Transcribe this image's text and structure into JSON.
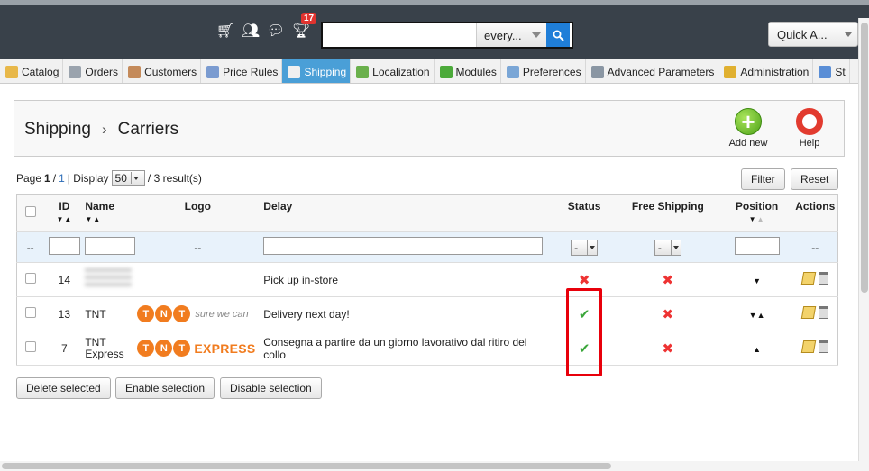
{
  "header": {
    "notifications_count": "17",
    "search": {
      "value": "",
      "placeholder": "",
      "scope": "every..."
    },
    "quick_access": "Quick A..."
  },
  "menu": [
    {
      "label": "Catalog",
      "icon": "folder-icon",
      "color": "#e8b84a"
    },
    {
      "label": "Orders",
      "icon": "cart-icon",
      "color": "#9aa3ad"
    },
    {
      "label": "Customers",
      "icon": "user-icon",
      "color": "#c48a5a"
    },
    {
      "label": "Price Rules",
      "icon": "price-tag-icon",
      "color": "#7a9bd0"
    },
    {
      "label": "Shipping",
      "icon": "truck-icon",
      "color": "#f0f0f0",
      "active": true
    },
    {
      "label": "Localization",
      "icon": "globe-icon",
      "color": "#6ab04c"
    },
    {
      "label": "Modules",
      "icon": "puzzle-icon",
      "color": "#4caa3a"
    },
    {
      "label": "Preferences",
      "icon": "window-icon",
      "color": "#7aa6d6"
    },
    {
      "label": "Advanced Parameters",
      "icon": "wrench-icon",
      "color": "#8a96a3"
    },
    {
      "label": "Administration",
      "icon": "key-icon",
      "color": "#e0b030"
    },
    {
      "label": "St",
      "icon": "stats-icon",
      "color": "#5a8ed6"
    }
  ],
  "page": {
    "breadcrumb": [
      "Shipping",
      "Carriers"
    ],
    "toolbar": {
      "add_new": "Add new",
      "help": "Help"
    }
  },
  "pagination": {
    "page_label": "Page",
    "current": "1",
    "total": "1",
    "display_label": "| Display",
    "per_page": "50",
    "results": "/ 3 result(s)",
    "filter": "Filter",
    "reset": "Reset"
  },
  "table": {
    "columns": {
      "id": "ID",
      "name": "Name",
      "logo": "Logo",
      "delay": "Delay",
      "status": "Status",
      "free_shipping": "Free Shipping",
      "position": "Position",
      "actions": "Actions"
    },
    "filter_row": {
      "dash": "--",
      "status_select": "-",
      "free_select": "-"
    },
    "rows": [
      {
        "id": "14",
        "name": "",
        "logo": "",
        "delay": "Pick up in-store",
        "status": "disabled",
        "free_shipping": "no",
        "position": "down"
      },
      {
        "id": "13",
        "name": "TNT",
        "logo": "TNT sure we can",
        "delay": "Delivery next day!",
        "status": "enabled",
        "free_shipping": "no",
        "position": "both"
      },
      {
        "id": "7",
        "name": "TNT Express",
        "logo": "TNT EXPRESS",
        "delay": "Consegna a partire da un giorno lavorativo dal ritiro del collo",
        "status": "enabled",
        "free_shipping": "no",
        "position": "up"
      }
    ]
  },
  "logos": {
    "tnt_letters": [
      "T",
      "N",
      "T"
    ],
    "tnt_slogan": "sure we can",
    "tnt_express": "EXPRESS"
  },
  "bulk_actions": {
    "delete": "Delete selected",
    "enable": "Enable selection",
    "disable": "Disable selection"
  },
  "colors": {
    "accent": "#4a9fd7",
    "header_bg": "#39414a",
    "highlight": "#e8000b"
  }
}
